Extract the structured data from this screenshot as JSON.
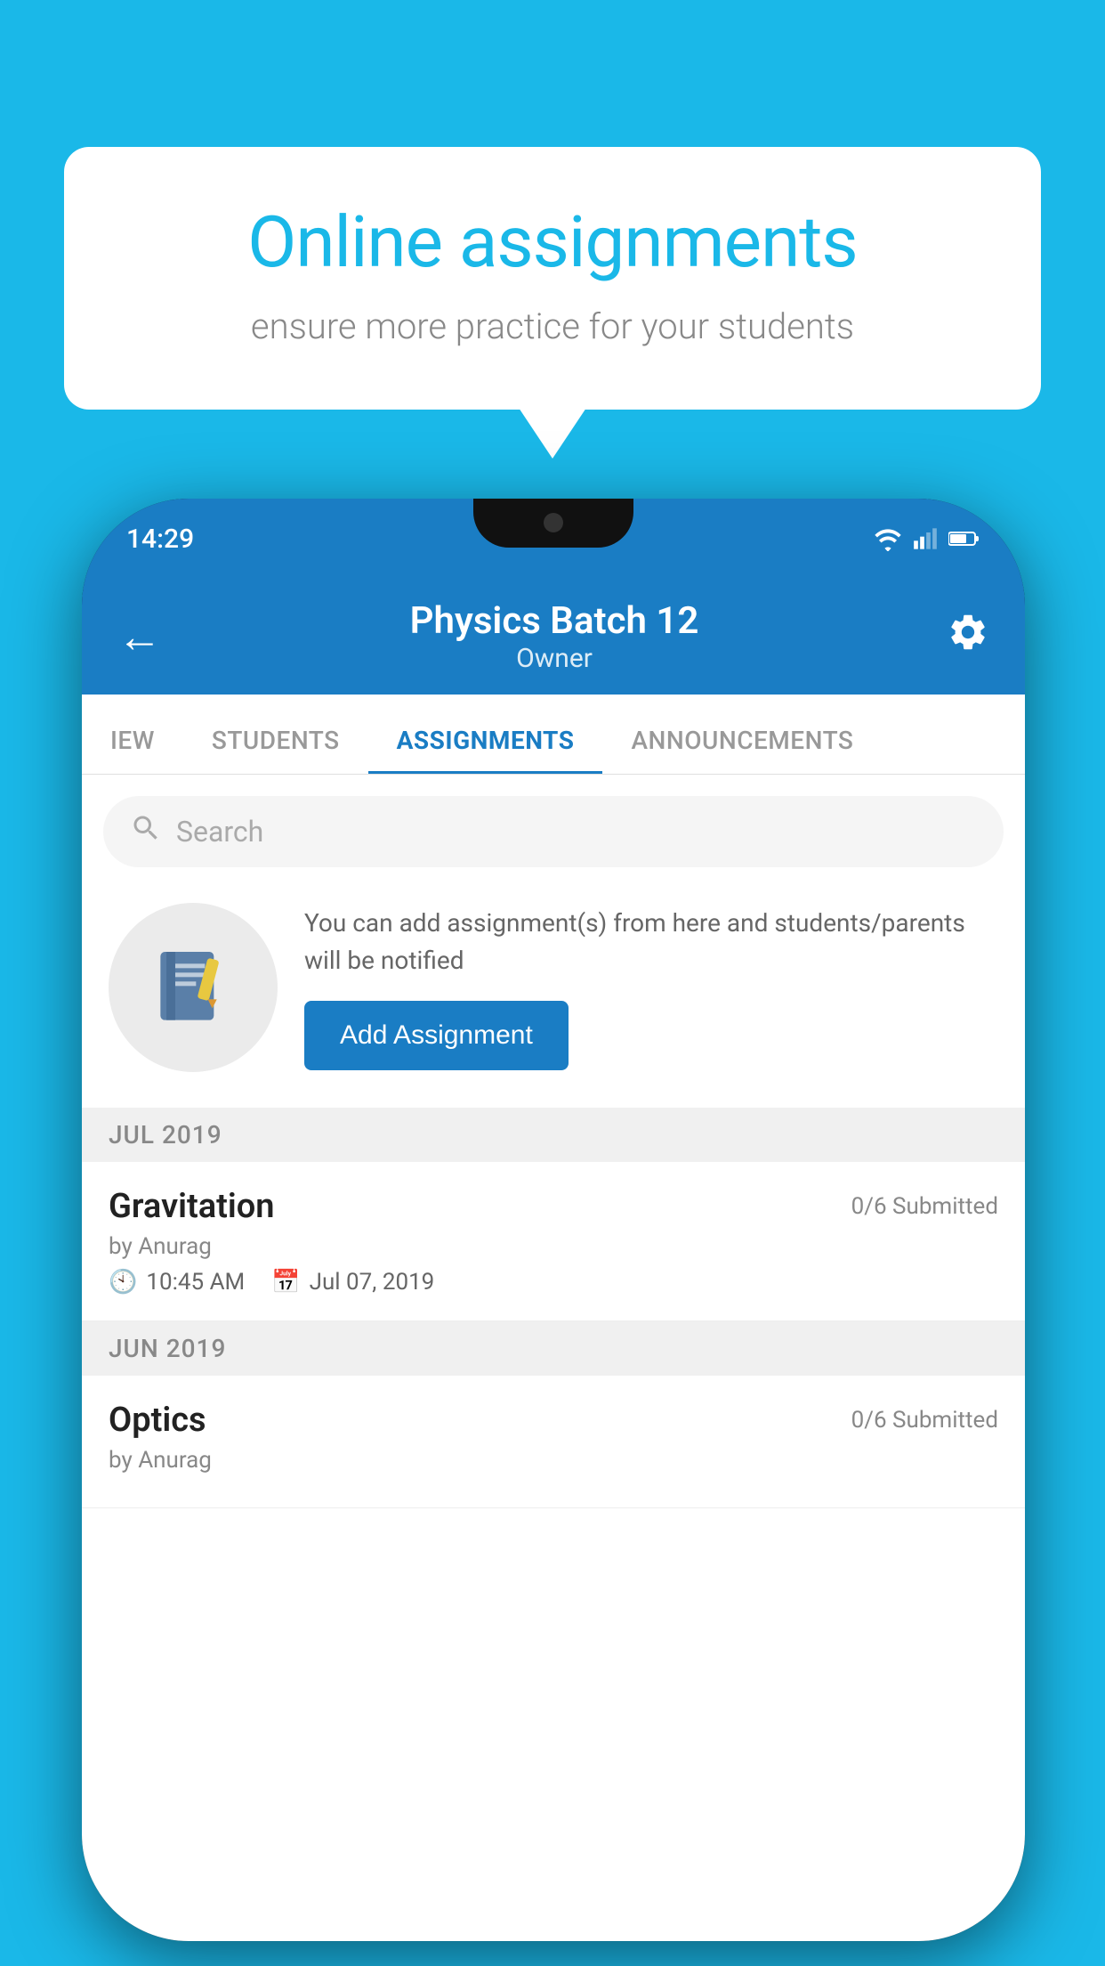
{
  "background": {
    "color": "#1ab8e8"
  },
  "speech_bubble": {
    "heading": "Online assignments",
    "subtext": "ensure more practice for your students"
  },
  "phone": {
    "status_bar": {
      "time": "14:29"
    },
    "header": {
      "title": "Physics Batch 12",
      "subtitle": "Owner",
      "back_label": "←",
      "settings_label": "⚙"
    },
    "tabs": [
      {
        "label": "IEW",
        "active": false
      },
      {
        "label": "STUDENTS",
        "active": false
      },
      {
        "label": "ASSIGNMENTS",
        "active": true
      },
      {
        "label": "ANNOUNCEMENTS",
        "active": false
      }
    ],
    "search": {
      "placeholder": "Search"
    },
    "promo": {
      "description": "You can add assignment(s) from here and students/parents will be notified",
      "button_label": "Add Assignment"
    },
    "assignment_groups": [
      {
        "month": "JUL 2019",
        "assignments": [
          {
            "title": "Gravitation",
            "submitted": "0/6 Submitted",
            "by": "by Anurag",
            "time": "10:45 AM",
            "date": "Jul 07, 2019"
          }
        ]
      },
      {
        "month": "JUN 2019",
        "assignments": [
          {
            "title": "Optics",
            "submitted": "0/6 Submitted",
            "by": "by Anurag",
            "time": "",
            "date": ""
          }
        ]
      }
    ]
  }
}
